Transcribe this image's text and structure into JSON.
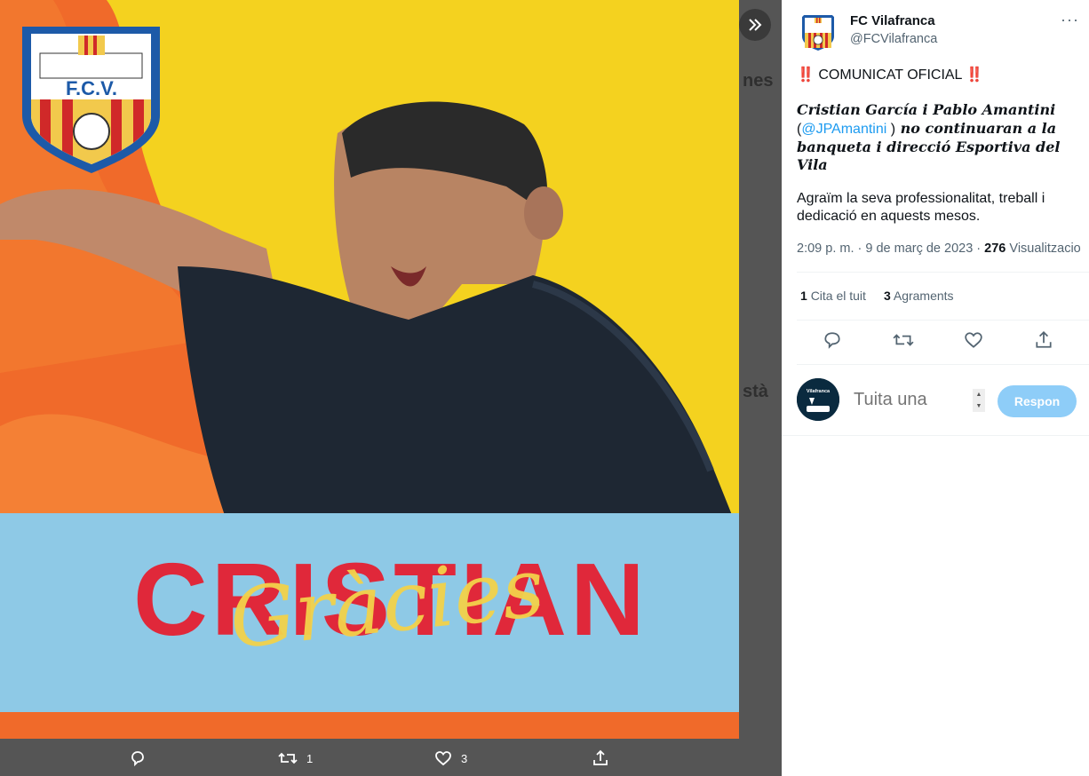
{
  "media": {
    "crest_text": "F.C.V.",
    "banner_name": "CRISTIAN",
    "banner_script": "Gràcies",
    "actions": {
      "retweets": "1",
      "likes": "3"
    }
  },
  "tweet": {
    "name": "FC Vilafranca",
    "handle": "@FCVilafranca",
    "more": "···",
    "line1": "‼️ COMUNICAT OFICIAL ‼️",
    "line2_names": "Cristian García i Pablo Amantini",
    "line2_open": " (",
    "line2_mention": "@JPAmantini",
    "line2_close": " )",
    "line2_rest": " no continuaran a la banqueta i direcció Esportiva del Vila",
    "line3": "Agraïm la seva professionalitat, treball i dedicació en aquests mesos.",
    "time": "2:09 p. m. · 9 de març de 2023 · ",
    "views_count": "276",
    "views_label": " Visualitzacio",
    "stats": {
      "quotes_count": "1",
      "quotes_label": "Cita el tuit",
      "likes_count": "3",
      "likes_label": "Agraments"
    }
  },
  "reply": {
    "avatar_text": "Vilafranca",
    "placeholder": "Tuita una",
    "button": "Respon"
  },
  "colors": {
    "accent": "#1d9bf0",
    "reply_button": "#8ecdf8",
    "banner_red": "#e0283a",
    "banner_blue": "#8ec9e6",
    "bg_yellow": "#f4d21f",
    "bg_orange": "#f06a2a"
  }
}
